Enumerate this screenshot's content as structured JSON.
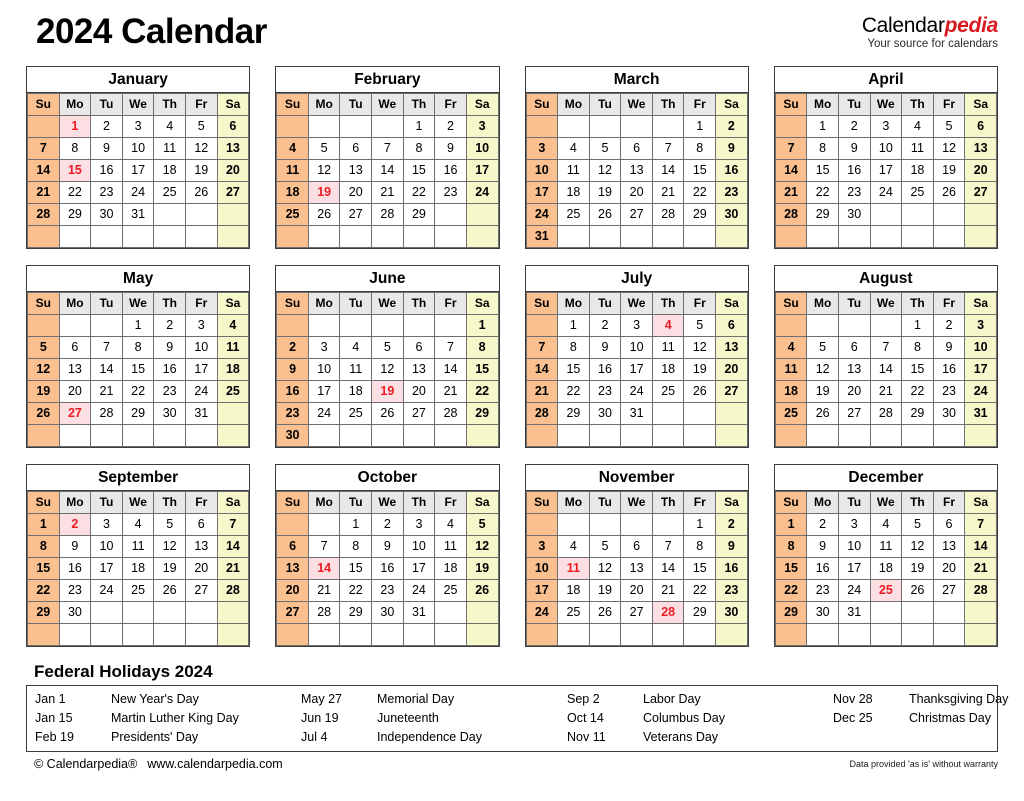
{
  "header": {
    "title": "2024 Calendar",
    "brand_name_dark": "Calendar",
    "brand_name_red": "pedia",
    "brand_tagline": "Your source for calendars",
    "brand_red_hex": "#d71920"
  },
  "weekday_headers": [
    "Su",
    "Mo",
    "Tu",
    "We",
    "Th",
    "Fr",
    "Sa"
  ],
  "colors": {
    "sunday_bg": "#fac090",
    "saturday_bg": "#f7f7cc",
    "weekday_header_bg": "#e8e8e8",
    "holiday_bg": "#fcdfe3",
    "holiday_text": "#ee1c25",
    "border": "#6f6f6f",
    "outer_border": "#3b3b3b"
  },
  "months": [
    {
      "name": "January",
      "weeks": [
        [
          "",
          "1",
          "2",
          "3",
          "4",
          "5",
          "6"
        ],
        [
          "7",
          "8",
          "9",
          "10",
          "11",
          "12",
          "13"
        ],
        [
          "14",
          "15",
          "16",
          "17",
          "18",
          "19",
          "20"
        ],
        [
          "21",
          "22",
          "23",
          "24",
          "25",
          "26",
          "27"
        ],
        [
          "28",
          "29",
          "30",
          "31",
          "",
          "",
          ""
        ],
        [
          "",
          "",
          "",
          "",
          "",
          "",
          ""
        ]
      ],
      "holidays": [
        "1",
        "15"
      ]
    },
    {
      "name": "February",
      "weeks": [
        [
          "",
          "",
          "",
          "",
          "1",
          "2",
          "3"
        ],
        [
          "4",
          "5",
          "6",
          "7",
          "8",
          "9",
          "10"
        ],
        [
          "11",
          "12",
          "13",
          "14",
          "15",
          "16",
          "17"
        ],
        [
          "18",
          "19",
          "20",
          "21",
          "22",
          "23",
          "24"
        ],
        [
          "25",
          "26",
          "27",
          "28",
          "29",
          "",
          ""
        ],
        [
          "",
          "",
          "",
          "",
          "",
          "",
          ""
        ]
      ],
      "holidays": [
        "19"
      ]
    },
    {
      "name": "March",
      "weeks": [
        [
          "",
          "",
          "",
          "",
          "",
          "1",
          "2"
        ],
        [
          "3",
          "4",
          "5",
          "6",
          "7",
          "8",
          "9"
        ],
        [
          "10",
          "11",
          "12",
          "13",
          "14",
          "15",
          "16"
        ],
        [
          "17",
          "18",
          "19",
          "20",
          "21",
          "22",
          "23"
        ],
        [
          "24",
          "25",
          "26",
          "27",
          "28",
          "29",
          "30"
        ],
        [
          "31",
          "",
          "",
          "",
          "",
          "",
          ""
        ]
      ],
      "holidays": []
    },
    {
      "name": "April",
      "weeks": [
        [
          "",
          "1",
          "2",
          "3",
          "4",
          "5",
          "6"
        ],
        [
          "7",
          "8",
          "9",
          "10",
          "11",
          "12",
          "13"
        ],
        [
          "14",
          "15",
          "16",
          "17",
          "18",
          "19",
          "20"
        ],
        [
          "21",
          "22",
          "23",
          "24",
          "25",
          "26",
          "27"
        ],
        [
          "28",
          "29",
          "30",
          "",
          "",
          "",
          ""
        ],
        [
          "",
          "",
          "",
          "",
          "",
          "",
          ""
        ]
      ],
      "holidays": []
    },
    {
      "name": "May",
      "weeks": [
        [
          "",
          "",
          "",
          "1",
          "2",
          "3",
          "4"
        ],
        [
          "5",
          "6",
          "7",
          "8",
          "9",
          "10",
          "11"
        ],
        [
          "12",
          "13",
          "14",
          "15",
          "16",
          "17",
          "18"
        ],
        [
          "19",
          "20",
          "21",
          "22",
          "23",
          "24",
          "25"
        ],
        [
          "26",
          "27",
          "28",
          "29",
          "30",
          "31",
          ""
        ],
        [
          "",
          "",
          "",
          "",
          "",
          "",
          ""
        ]
      ],
      "holidays": [
        "27"
      ]
    },
    {
      "name": "June",
      "weeks": [
        [
          "",
          "",
          "",
          "",
          "",
          "",
          "1"
        ],
        [
          "2",
          "3",
          "4",
          "5",
          "6",
          "7",
          "8"
        ],
        [
          "9",
          "10",
          "11",
          "12",
          "13",
          "14",
          "15"
        ],
        [
          "16",
          "17",
          "18",
          "19",
          "20",
          "21",
          "22"
        ],
        [
          "23",
          "24",
          "25",
          "26",
          "27",
          "28",
          "29"
        ],
        [
          "30",
          "",
          "",
          "",
          "",
          "",
          ""
        ]
      ],
      "holidays": [
        "19"
      ]
    },
    {
      "name": "July",
      "weeks": [
        [
          "",
          "1",
          "2",
          "3",
          "4",
          "5",
          "6"
        ],
        [
          "7",
          "8",
          "9",
          "10",
          "11",
          "12",
          "13"
        ],
        [
          "14",
          "15",
          "16",
          "17",
          "18",
          "19",
          "20"
        ],
        [
          "21",
          "22",
          "23",
          "24",
          "25",
          "26",
          "27"
        ],
        [
          "28",
          "29",
          "30",
          "31",
          "",
          "",
          ""
        ],
        [
          "",
          "",
          "",
          "",
          "",
          "",
          ""
        ]
      ],
      "holidays": [
        "4"
      ]
    },
    {
      "name": "August",
      "weeks": [
        [
          "",
          "",
          "",
          "",
          "1",
          "2",
          "3"
        ],
        [
          "4",
          "5",
          "6",
          "7",
          "8",
          "9",
          "10"
        ],
        [
          "11",
          "12",
          "13",
          "14",
          "15",
          "16",
          "17"
        ],
        [
          "18",
          "19",
          "20",
          "21",
          "22",
          "23",
          "24"
        ],
        [
          "25",
          "26",
          "27",
          "28",
          "29",
          "30",
          "31"
        ],
        [
          "",
          "",
          "",
          "",
          "",
          "",
          ""
        ]
      ],
      "holidays": []
    },
    {
      "name": "September",
      "weeks": [
        [
          "1",
          "2",
          "3",
          "4",
          "5",
          "6",
          "7"
        ],
        [
          "8",
          "9",
          "10",
          "11",
          "12",
          "13",
          "14"
        ],
        [
          "15",
          "16",
          "17",
          "18",
          "19",
          "20",
          "21"
        ],
        [
          "22",
          "23",
          "24",
          "25",
          "26",
          "27",
          "28"
        ],
        [
          "29",
          "30",
          "",
          "",
          "",
          "",
          ""
        ],
        [
          "",
          "",
          "",
          "",
          "",
          "",
          ""
        ]
      ],
      "holidays": [
        "2"
      ]
    },
    {
      "name": "October",
      "weeks": [
        [
          "",
          "",
          "1",
          "2",
          "3",
          "4",
          "5"
        ],
        [
          "6",
          "7",
          "8",
          "9",
          "10",
          "11",
          "12"
        ],
        [
          "13",
          "14",
          "15",
          "16",
          "17",
          "18",
          "19"
        ],
        [
          "20",
          "21",
          "22",
          "23",
          "24",
          "25",
          "26"
        ],
        [
          "27",
          "28",
          "29",
          "30",
          "31",
          "",
          ""
        ],
        [
          "",
          "",
          "",
          "",
          "",
          "",
          ""
        ]
      ],
      "holidays": [
        "14"
      ]
    },
    {
      "name": "November",
      "weeks": [
        [
          "",
          "",
          "",
          "",
          "",
          "1",
          "2"
        ],
        [
          "3",
          "4",
          "5",
          "6",
          "7",
          "8",
          "9"
        ],
        [
          "10",
          "11",
          "12",
          "13",
          "14",
          "15",
          "16"
        ],
        [
          "17",
          "18",
          "19",
          "20",
          "21",
          "22",
          "23"
        ],
        [
          "24",
          "25",
          "26",
          "27",
          "28",
          "29",
          "30"
        ],
        [
          "",
          "",
          "",
          "",
          "",
          "",
          ""
        ]
      ],
      "holidays": [
        "11",
        "28"
      ]
    },
    {
      "name": "December",
      "weeks": [
        [
          "1",
          "2",
          "3",
          "4",
          "5",
          "6",
          "7"
        ],
        [
          "8",
          "9",
          "10",
          "11",
          "12",
          "13",
          "14"
        ],
        [
          "15",
          "16",
          "17",
          "18",
          "19",
          "20",
          "21"
        ],
        [
          "22",
          "23",
          "24",
          "25",
          "26",
          "27",
          "28"
        ],
        [
          "29",
          "30",
          "31",
          "",
          "",
          "",
          ""
        ],
        [
          "",
          "",
          "",
          "",
          "",
          "",
          ""
        ]
      ],
      "holidays": [
        "25"
      ]
    }
  ],
  "footer": {
    "holidays_title": "Federal Holidays 2024",
    "holiday_rows": [
      [
        {
          "date": "Jan 1",
          "name": "New Year's Day"
        },
        {
          "date": "May 27",
          "name": "Memorial Day"
        },
        {
          "date": "Sep 2",
          "name": "Labor Day"
        },
        {
          "date": "Nov 28",
          "name": "Thanksgiving Day"
        }
      ],
      [
        {
          "date": "Jan 15",
          "name": "Martin Luther King Day"
        },
        {
          "date": "Jun 19",
          "name": "Juneteenth"
        },
        {
          "date": "Oct 14",
          "name": "Columbus Day"
        },
        {
          "date": "Dec 25",
          "name": "Christmas Day"
        }
      ],
      [
        {
          "date": "Feb 19",
          "name": "Presidents' Day"
        },
        {
          "date": "Jul 4",
          "name": "Independence Day"
        },
        {
          "date": "Nov 11",
          "name": "Veterans Day"
        },
        {
          "date": "",
          "name": ""
        }
      ]
    ],
    "copyright": "© Calendarpedia®",
    "website": "www.calendarpedia.com",
    "disclaimer": "Data provided 'as is' without warranty"
  }
}
